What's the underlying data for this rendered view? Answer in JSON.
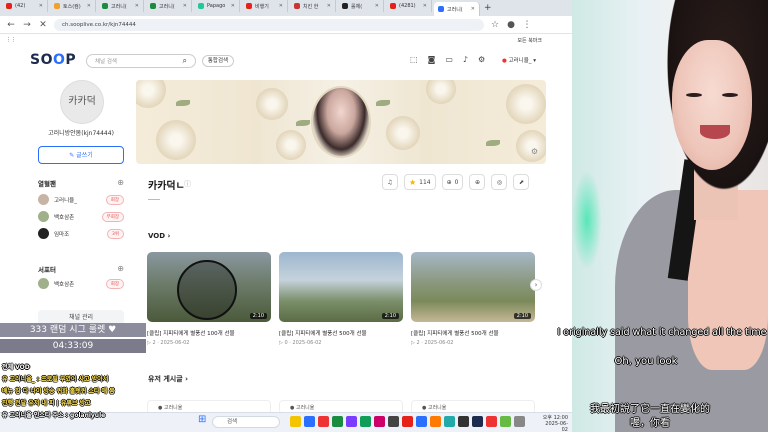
{
  "browser": {
    "tabs": [
      {
        "label": "(42)",
        "color": "#e62117"
      },
      {
        "label": "토스(컴)",
        "color": "#f1a12a"
      },
      {
        "label": "고러니(",
        "color": "#1a8c3f"
      },
      {
        "label": "고러니(",
        "color": "#1a8c3f"
      },
      {
        "label": "Papago",
        "color": "#20c997"
      },
      {
        "label": "비행기",
        "color": "#e62117"
      },
      {
        "label": "치킨 한",
        "color": "#cc3333"
      },
      {
        "label": "롤체(",
        "color": "#222222"
      },
      {
        "label": "(4281)",
        "color": "#e62117"
      },
      {
        "label": "고러니(",
        "color": "#2b6fff",
        "active": true
      }
    ],
    "url": "ch.sooplive.co.kr/kjn74444",
    "bookmark_folder": "모든 북마크"
  },
  "site": {
    "logo_a": "SO",
    "logo_b": "P",
    "search_placeholder": "채널 검색",
    "search_all": "통합검색",
    "user_label": "고러니율_"
  },
  "sidebar": {
    "avatar_text": "카카덕",
    "channel_name": "고러니방안봄(kjn74444)",
    "write_button": "✎ 글쓰기",
    "fanclub_title": "열혈팬",
    "fans": [
      {
        "name": "고러니율_",
        "badge": "회장"
      },
      {
        "name": "백호삼촌",
        "badge": "부회장"
      },
      {
        "name": "임마조",
        "badge": "3위"
      }
    ],
    "supporter_title": "서포터",
    "supporters": [
      {
        "name": "백호삼촌",
        "badge": "회장"
      }
    ],
    "manage_button": "채널 관리"
  },
  "channel": {
    "title": "카카덕ㄴ",
    "favorite_count": "114",
    "subscribe_count": "0",
    "vod_label": "VOD",
    "vods": [
      {
        "title": "[클립] 지피티에게 별풍선 100개 선물",
        "duration": "2:10",
        "views": "2",
        "date": "2025-06-02"
      },
      {
        "title": "[클립] 지피티에게 별풍선 500개 선물",
        "duration": "2:10",
        "views": "0",
        "date": "2025-06-02"
      },
      {
        "title": "[클립] 지피티에게 별풍선 500개 선물",
        "duration": "2:10",
        "views": "2",
        "date": "2025-06-02"
      }
    ],
    "board_label": "유저 게시글",
    "board_cards": [
      "고러니율",
      "고러니율",
      "고러니율"
    ]
  },
  "overlay": {
    "roulette": "333 랜덤 시그 룰렛 ♥",
    "timer": "04:33:09",
    "chat": [
      {
        "text": "전체 VOD",
        "color": "#ffffff"
      },
      {
        "text": "유 고러니율_ : 프로필 부였어 사고 받아서",
        "color": "#ffe14d"
      },
      {
        "text": "배뉴 참 다 나이 방송 퀴화 홀렛퀴 스타 매 봄",
        "color": "#ffe14d"
      },
      {
        "text": "진행 전달 유저 내 피 | 유튜브 방고",
        "color": "#ffe14d"
      },
      {
        "text": "유 고러니율 인스타 주소 : golaniyule",
        "color": "#ffffff"
      }
    ]
  },
  "taskbar": {
    "search": "검색",
    "time": "오후 12:00",
    "date": "2025-06-02"
  },
  "subtitles": {
    "en_1": "I originally said what it changed all the time",
    "en_2": "Oh, you look",
    "zh_1": "我最初說了它一直在變化的",
    "zh_2": "喔，你看"
  }
}
